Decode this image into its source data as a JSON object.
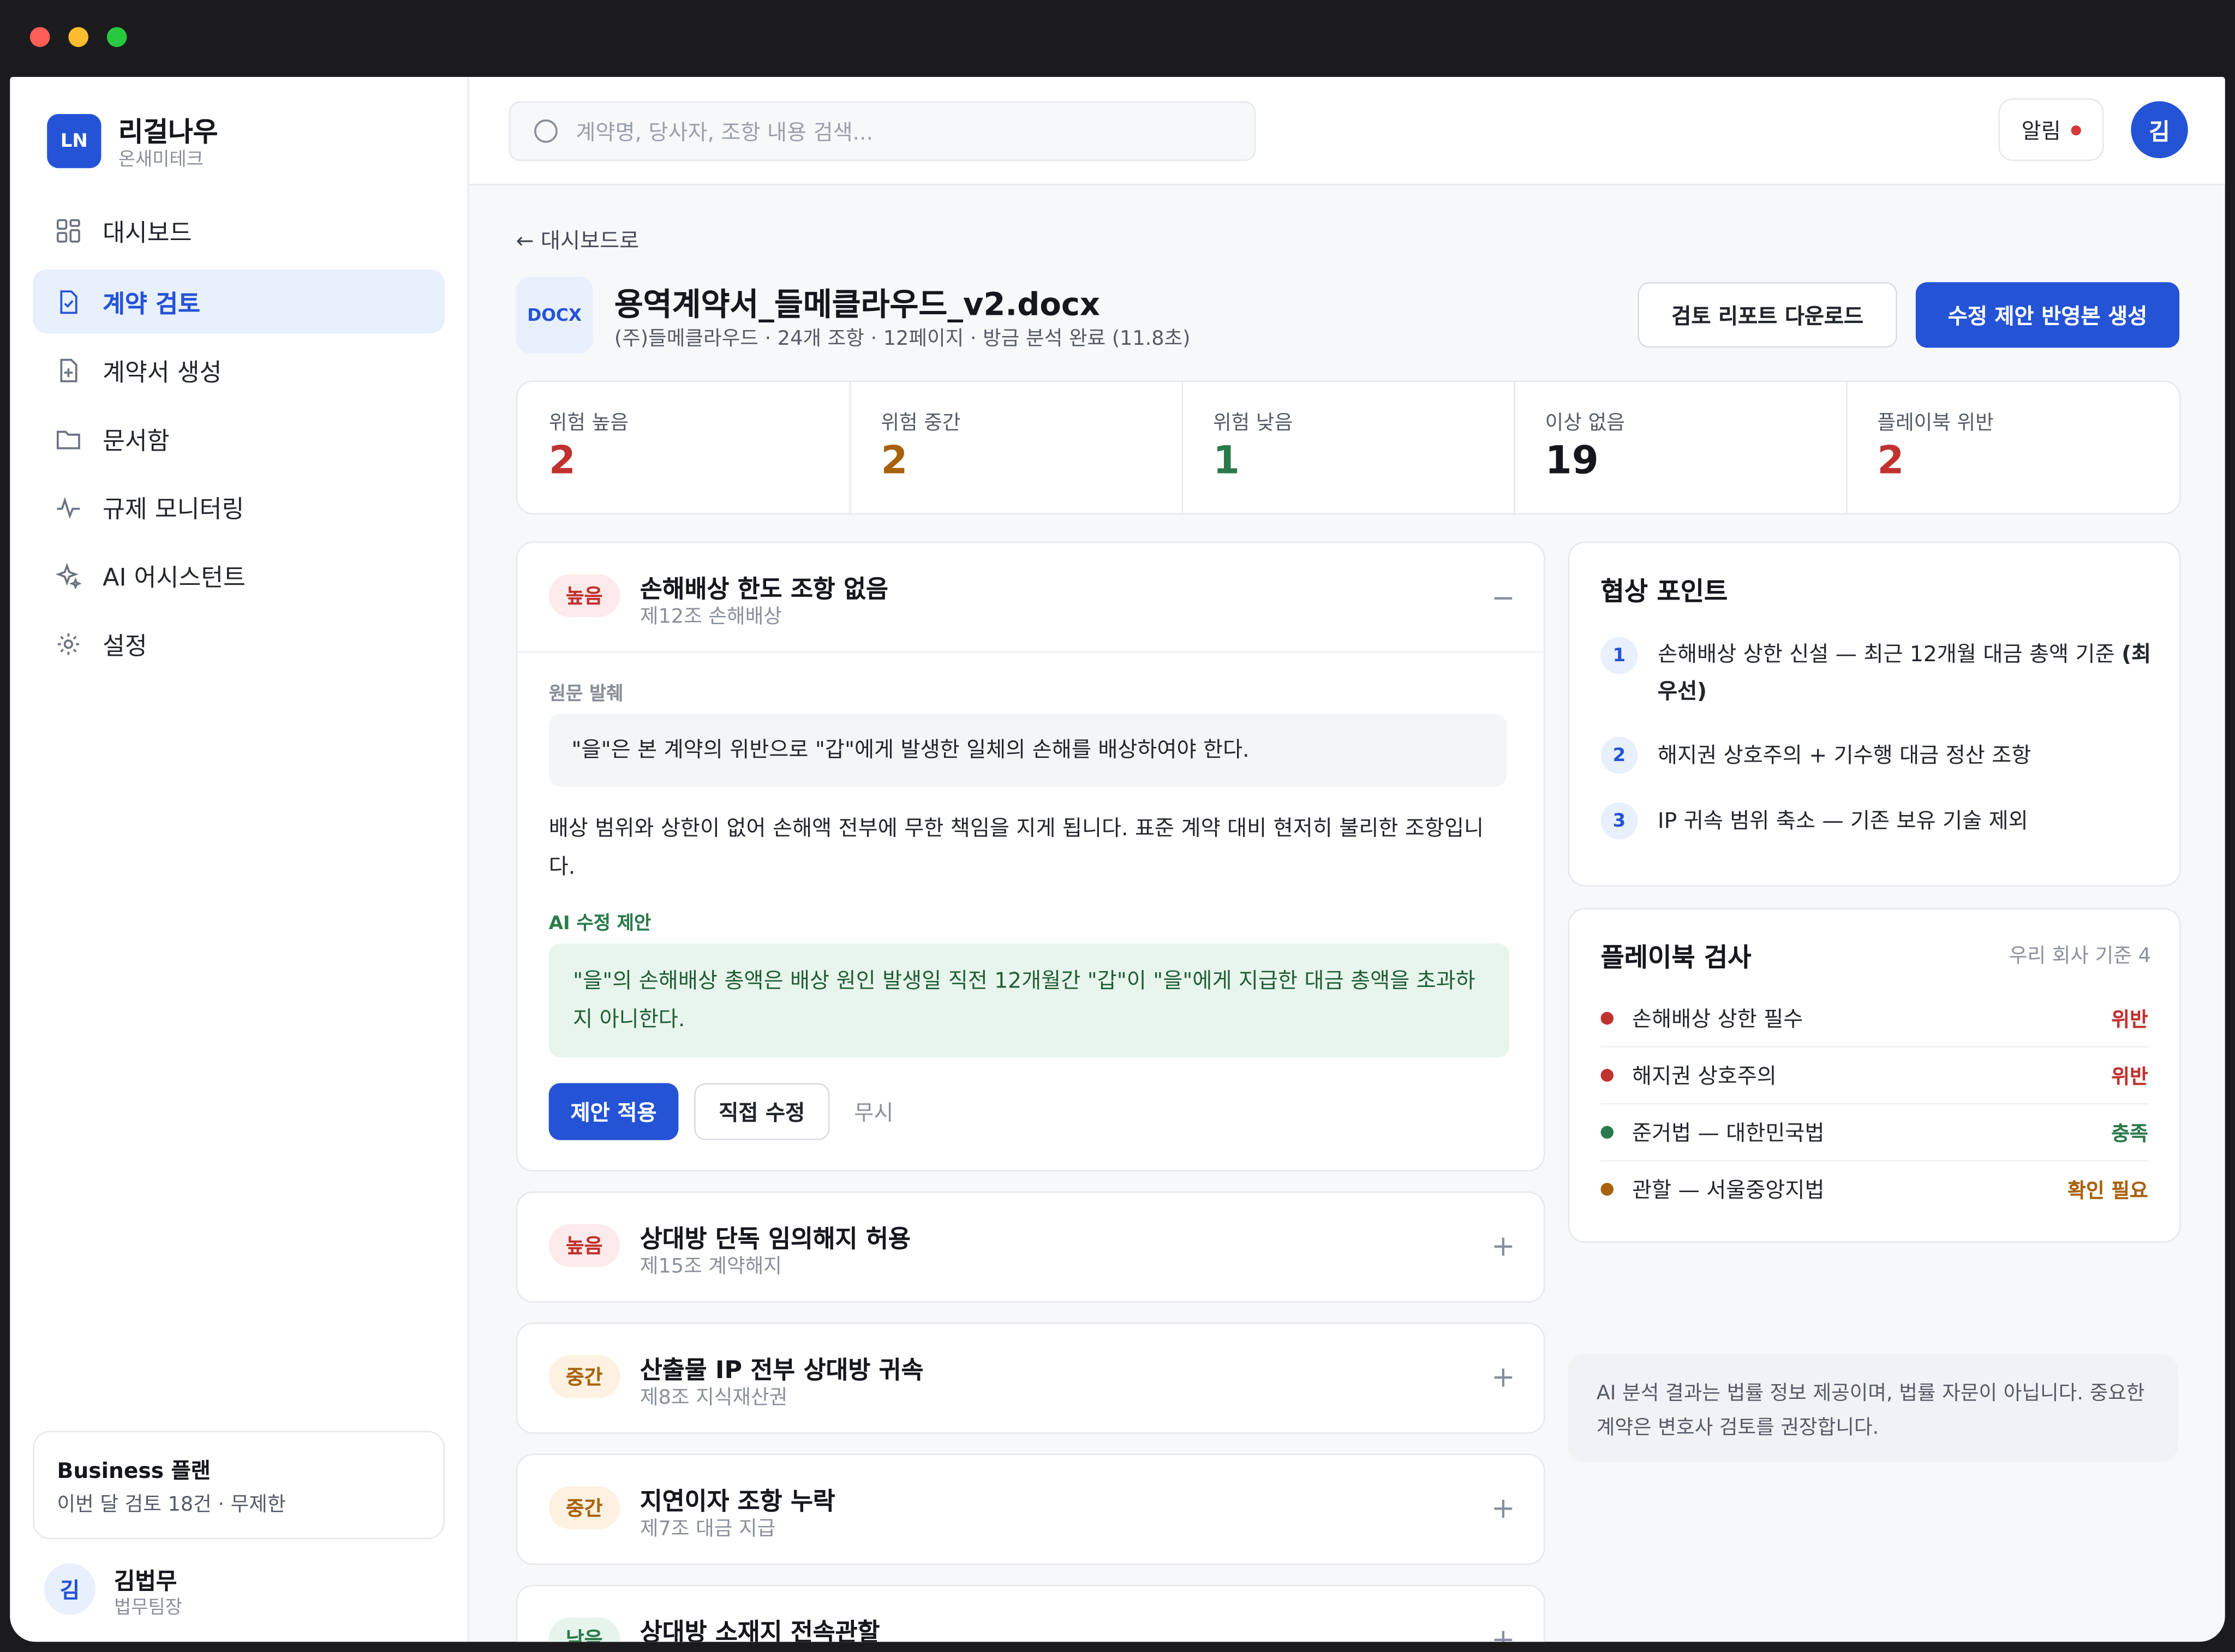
{
  "brand": {
    "logo": "LN",
    "name": "리걸나우",
    "org": "온새미테크"
  },
  "nav": [
    {
      "label": "대시보드",
      "icon": "grid-icon",
      "active": false
    },
    {
      "label": "계약 검토",
      "icon": "doc-check-icon",
      "active": true
    },
    {
      "label": "계약서 생성",
      "icon": "doc-plus-icon",
      "active": false
    },
    {
      "label": "문서함",
      "icon": "folder-icon",
      "active": false
    },
    {
      "label": "규제 모니터링",
      "icon": "pulse-icon",
      "active": false
    },
    {
      "label": "AI 어시스턴트",
      "icon": "sparkle-icon",
      "active": false
    },
    {
      "label": "설정",
      "icon": "gear-icon",
      "active": false
    }
  ],
  "plan": {
    "title": "Business 플랜",
    "desc": "이번 달 검토 18건 · 무제한"
  },
  "user": {
    "initial": "김",
    "name": "김법무",
    "role": "법무팀장"
  },
  "search": {
    "placeholder": "계약명, 당사자, 조항 내용 검색..."
  },
  "topbar": {
    "alert_label": "알림",
    "avatar_initial": "김"
  },
  "doc": {
    "back": "← 대시보드로",
    "badge": "DOCX",
    "title": "용역계약서_들메클라우드_v2.docx",
    "meta": "(주)들메클라우드 · 24개 조항 · 12페이지 · 방금 분석 완료 (11.8초)",
    "download_label": "검토 리포트 다운로드",
    "generate_label": "수정 제안 반영본 생성"
  },
  "stats": [
    {
      "label": "위험 높음",
      "value": "2",
      "color": "#c0322f"
    },
    {
      "label": "위험 중간",
      "value": "2",
      "color": "#a8620b"
    },
    {
      "label": "위험 낮음",
      "value": "1",
      "color": "#2b7a4b"
    },
    {
      "label": "이상 없음",
      "value": "19",
      "color": "#15171c"
    },
    {
      "label": "플레이북 위반",
      "value": "2",
      "color": "#c0322f"
    }
  ],
  "expanded_issue": {
    "severity": "높음",
    "title": "손해배상 한도 조항 없음",
    "clause": "제12조 손해배상",
    "toggle": "−",
    "excerpt_label": "원문 발췌",
    "excerpt": "\"을\"은 본 계약의 위반으로 \"갑\"에게 발생한 일체의 손해를 배상하여야 한다.",
    "explanation": "배상 범위와 상한이 없어 손해액 전부에 무한 책임을 지게 됩니다. 표준 계약 대비 현저히 불리한 조항입니다.",
    "suggestion_label": "AI 수정 제안",
    "suggestion": "\"을\"의 손해배상 총액은 배상 원인 발생일 직전 12개월간 \"갑\"이 \"을\"에게 지급한 대금 총액을 초과하지 아니한다.",
    "apply_label": "제안 적용",
    "edit_label": "직접 수정",
    "ignore_label": "무시"
  },
  "issues": [
    {
      "severity": "높음",
      "level": "high",
      "title": "상대방 단독 임의해지 허용",
      "clause": "제15조 계약해지",
      "toggle": "+"
    },
    {
      "severity": "중간",
      "level": "mid",
      "title": "산출물 IP 전부 상대방 귀속",
      "clause": "제8조 지식재산권",
      "toggle": "+"
    },
    {
      "severity": "중간",
      "level": "mid",
      "title": "지연이자 조항 누락",
      "clause": "제7조 대금 지급",
      "toggle": "+"
    },
    {
      "severity": "낮음",
      "level": "low",
      "title": "상대방 소재지 전속관할",
      "clause": "",
      "toggle": "+"
    }
  ],
  "negotiation": {
    "title": "협상 포인트",
    "items": [
      {
        "num": "1",
        "text": "손해배상 상한 신설 — 최근 12개월 대금 총액 기준",
        "note": "(최우선)"
      },
      {
        "num": "2",
        "text": "해지권 상호주의 + 기수행 대금 정산 조항",
        "note": ""
      },
      {
        "num": "3",
        "text": "IP 귀속 범위 축소 — 기존 보유 기술 제외",
        "note": ""
      }
    ]
  },
  "playbook": {
    "title": "플레이북 검사",
    "subtitle": "우리 회사 기준 4",
    "items": [
      {
        "name": "손해배상 상한 필수",
        "status": "위반",
        "color": "#c0322f"
      },
      {
        "name": "해지권 상호주의",
        "status": "위반",
        "color": "#c0322f"
      },
      {
        "name": "준거법 — 대한민국법",
        "status": "충족",
        "color": "#2b7a4b"
      },
      {
        "name": "관할 — 서울중앙지법",
        "status": "확인 필요",
        "color": "#a8620b"
      }
    ]
  },
  "disclaimer": "AI 분석 결과는 법률 정보 제공이며, 법률 자문이 아닙니다. 중요한 계약은 변호사 검토를 권장합니다."
}
